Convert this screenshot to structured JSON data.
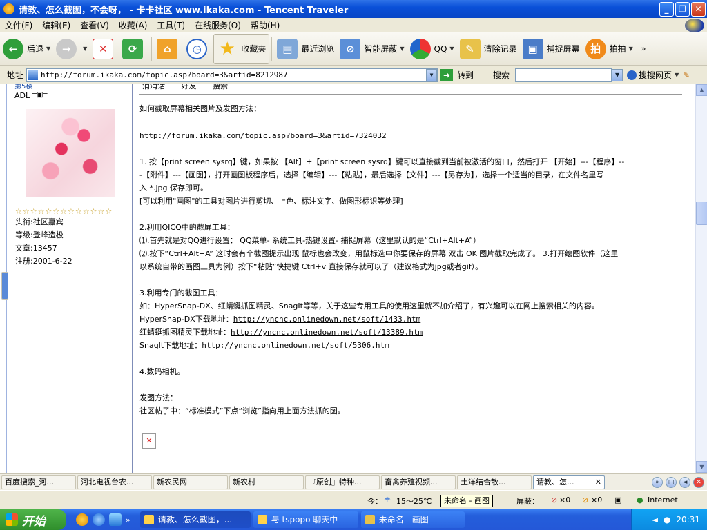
{
  "window": {
    "title": "请教、怎么截图，不会呀，  - 卡卡社区 www.ikaka.com - Tencent Traveler"
  },
  "menu": [
    "文件(F)",
    "编辑(E)",
    "查看(V)",
    "收藏(A)",
    "工具(T)",
    "在线服务(O)",
    "帮助(H)"
  ],
  "toolbar": {
    "back": "后退",
    "favorites": "收藏夹",
    "recent": "最近浏览",
    "block": "智能屏蔽",
    "qq": "QQ",
    "clear": "清除记录",
    "capture": "捕捉屏幕",
    "paipai": "拍拍"
  },
  "address": {
    "label": "地址",
    "url": "http://forum.ikaka.com/topic.asp?board=3&artid=8212987",
    "go": "转到",
    "search_label": "搜索",
    "search_web": "搜搜网页"
  },
  "post_top": {
    "floor": "第5楼",
    "actions": [
      "消消话",
      "好友",
      "搜索"
    ]
  },
  "user": {
    "name": "ADL",
    "title": "头衔:社区嘉宾",
    "level": "等级:登峰造极",
    "posts": "文章:13457",
    "registered": "注册:2001-6-22",
    "stars": "☆☆☆☆☆☆☆☆☆☆☆☆☆"
  },
  "post": {
    "l1": "如何截取屏幕相关图片及发图方法：",
    "link1": "http://forum.ikaka.com/topic.asp?board=3&artid=7324032",
    "l2": "1. 按【print screen sysrq】键，如果按 【Alt】+【print screen sysrq】键可以直接截到当前被激活的窗口，然后打开 【开始】---【程序】--",
    "l3": "-【附件】---【画图】，打开画图板程序后，选择【编辑】---【粘贴】，最后选择【文件】---【另存为】，选择一个适当的目录，在文件名里写",
    "l4": "入 *.jpg 保存即可。",
    "l5": "[可以利用\"画图\"的工具对图片进行剪切、上色、标注文字、做图形标识等处理]",
    "l6": "2.利用QICQ中的截屏工具：",
    "l7": "⑴.首先就是对QQ进行设置： QQ菜单- 系统工具-热键设置- 捕捉屏幕（这里默认的是“Ctrl+Alt+A”）",
    "l8": "⑵.按下“Ctrl+Alt+A” 这时会有个截图提示出现 鼠标也会改变，用鼠标选中你要保存的屏幕 双击 OK 图片截取完成了。 3.打开绘图软件（这里",
    "l9": "以系统自带的画图工具为例）按下“粘贴”快捷键 Ctrl+v 直接保存就可以了（建议格式为jpg或者gif）。",
    "l10": "3.利用专门的截图工具：",
    "l11": "如：HyperSnap-DX、红蜻蜓抓图精灵、SnagIt等等，关于这些专用工具的使用这里就不加介绍了，有兴趣可以在网上搜索相关的内容。",
    "l12a": "HyperSnap-DX下载地址：",
    "l12b": "http://yncnc.onlinedown.net/soft/1433.htm",
    "l13a": "红蜻蜓抓图精灵下载地址：",
    "l13b": "http://yncnc.onlinedown.net/soft/13389.htm",
    "l14a": "SnagIt下载地址：",
    "l14b": "http://yncnc.onlinedown.net/soft/5306.htm",
    "l15": "4.数码相机。",
    "l16": "发图方法：",
    "l17": "社区帖子中：“标准模式”下点“浏览”指向用上面方法抓的图。"
  },
  "tabs": [
    "百度搜索_河...",
    "河北电视台农...",
    "新农民网",
    "新农村",
    "『原创』特种...",
    "畜禽养殖视频...",
    "土洋结合散...",
    "请教、怎..."
  ],
  "status": {
    "weather_prefix": "今：",
    "temp": "15～25℃",
    "tooltip": "未命名 - 画图",
    "block_label": "屏蔽：",
    "count1": "×0",
    "count2": "×0",
    "zone": "Internet"
  },
  "taskbar": {
    "start": "开始",
    "tasks": [
      "请教、怎么截图，...",
      "与 tspopo 聊天中",
      "未命名 - 画图"
    ],
    "clock": "20:31"
  }
}
